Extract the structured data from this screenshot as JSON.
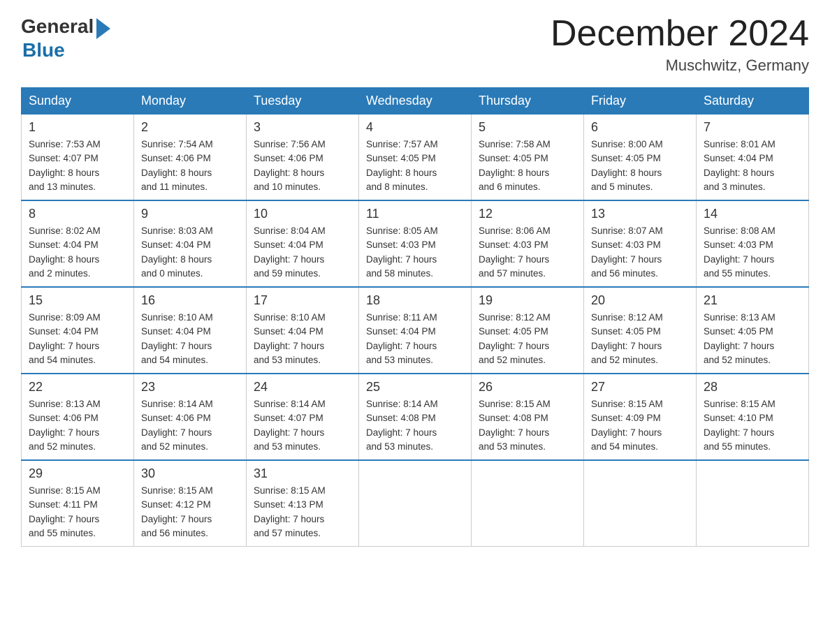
{
  "header": {
    "logo_general": "General",
    "logo_blue": "Blue",
    "title": "December 2024",
    "subtitle": "Muschwitz, Germany"
  },
  "days_of_week": [
    "Sunday",
    "Monday",
    "Tuesday",
    "Wednesday",
    "Thursday",
    "Friday",
    "Saturday"
  ],
  "weeks": [
    [
      {
        "day": "1",
        "sunrise": "7:53 AM",
        "sunset": "4:07 PM",
        "daylight": "8 hours and 13 minutes."
      },
      {
        "day": "2",
        "sunrise": "7:54 AM",
        "sunset": "4:06 PM",
        "daylight": "8 hours and 11 minutes."
      },
      {
        "day": "3",
        "sunrise": "7:56 AM",
        "sunset": "4:06 PM",
        "daylight": "8 hours and 10 minutes."
      },
      {
        "day": "4",
        "sunrise": "7:57 AM",
        "sunset": "4:05 PM",
        "daylight": "8 hours and 8 minutes."
      },
      {
        "day": "5",
        "sunrise": "7:58 AM",
        "sunset": "4:05 PM",
        "daylight": "8 hours and 6 minutes."
      },
      {
        "day": "6",
        "sunrise": "8:00 AM",
        "sunset": "4:05 PM",
        "daylight": "8 hours and 5 minutes."
      },
      {
        "day": "7",
        "sunrise": "8:01 AM",
        "sunset": "4:04 PM",
        "daylight": "8 hours and 3 minutes."
      }
    ],
    [
      {
        "day": "8",
        "sunrise": "8:02 AM",
        "sunset": "4:04 PM",
        "daylight": "8 hours and 2 minutes."
      },
      {
        "day": "9",
        "sunrise": "8:03 AM",
        "sunset": "4:04 PM",
        "daylight": "8 hours and 0 minutes."
      },
      {
        "day": "10",
        "sunrise": "8:04 AM",
        "sunset": "4:04 PM",
        "daylight": "7 hours and 59 minutes."
      },
      {
        "day": "11",
        "sunrise": "8:05 AM",
        "sunset": "4:03 PM",
        "daylight": "7 hours and 58 minutes."
      },
      {
        "day": "12",
        "sunrise": "8:06 AM",
        "sunset": "4:03 PM",
        "daylight": "7 hours and 57 minutes."
      },
      {
        "day": "13",
        "sunrise": "8:07 AM",
        "sunset": "4:03 PM",
        "daylight": "7 hours and 56 minutes."
      },
      {
        "day": "14",
        "sunrise": "8:08 AM",
        "sunset": "4:03 PM",
        "daylight": "7 hours and 55 minutes."
      }
    ],
    [
      {
        "day": "15",
        "sunrise": "8:09 AM",
        "sunset": "4:04 PM",
        "daylight": "7 hours and 54 minutes."
      },
      {
        "day": "16",
        "sunrise": "8:10 AM",
        "sunset": "4:04 PM",
        "daylight": "7 hours and 54 minutes."
      },
      {
        "day": "17",
        "sunrise": "8:10 AM",
        "sunset": "4:04 PM",
        "daylight": "7 hours and 53 minutes."
      },
      {
        "day": "18",
        "sunrise": "8:11 AM",
        "sunset": "4:04 PM",
        "daylight": "7 hours and 53 minutes."
      },
      {
        "day": "19",
        "sunrise": "8:12 AM",
        "sunset": "4:05 PM",
        "daylight": "7 hours and 52 minutes."
      },
      {
        "day": "20",
        "sunrise": "8:12 AM",
        "sunset": "4:05 PM",
        "daylight": "7 hours and 52 minutes."
      },
      {
        "day": "21",
        "sunrise": "8:13 AM",
        "sunset": "4:05 PM",
        "daylight": "7 hours and 52 minutes."
      }
    ],
    [
      {
        "day": "22",
        "sunrise": "8:13 AM",
        "sunset": "4:06 PM",
        "daylight": "7 hours and 52 minutes."
      },
      {
        "day": "23",
        "sunrise": "8:14 AM",
        "sunset": "4:06 PM",
        "daylight": "7 hours and 52 minutes."
      },
      {
        "day": "24",
        "sunrise": "8:14 AM",
        "sunset": "4:07 PM",
        "daylight": "7 hours and 53 minutes."
      },
      {
        "day": "25",
        "sunrise": "8:14 AM",
        "sunset": "4:08 PM",
        "daylight": "7 hours and 53 minutes."
      },
      {
        "day": "26",
        "sunrise": "8:15 AM",
        "sunset": "4:08 PM",
        "daylight": "7 hours and 53 minutes."
      },
      {
        "day": "27",
        "sunrise": "8:15 AM",
        "sunset": "4:09 PM",
        "daylight": "7 hours and 54 minutes."
      },
      {
        "day": "28",
        "sunrise": "8:15 AM",
        "sunset": "4:10 PM",
        "daylight": "7 hours and 55 minutes."
      }
    ],
    [
      {
        "day": "29",
        "sunrise": "8:15 AM",
        "sunset": "4:11 PM",
        "daylight": "7 hours and 55 minutes."
      },
      {
        "day": "30",
        "sunrise": "8:15 AM",
        "sunset": "4:12 PM",
        "daylight": "7 hours and 56 minutes."
      },
      {
        "day": "31",
        "sunrise": "8:15 AM",
        "sunset": "4:13 PM",
        "daylight": "7 hours and 57 minutes."
      },
      null,
      null,
      null,
      null
    ]
  ],
  "labels": {
    "sunrise": "Sunrise:",
    "sunset": "Sunset:",
    "daylight": "Daylight:"
  }
}
